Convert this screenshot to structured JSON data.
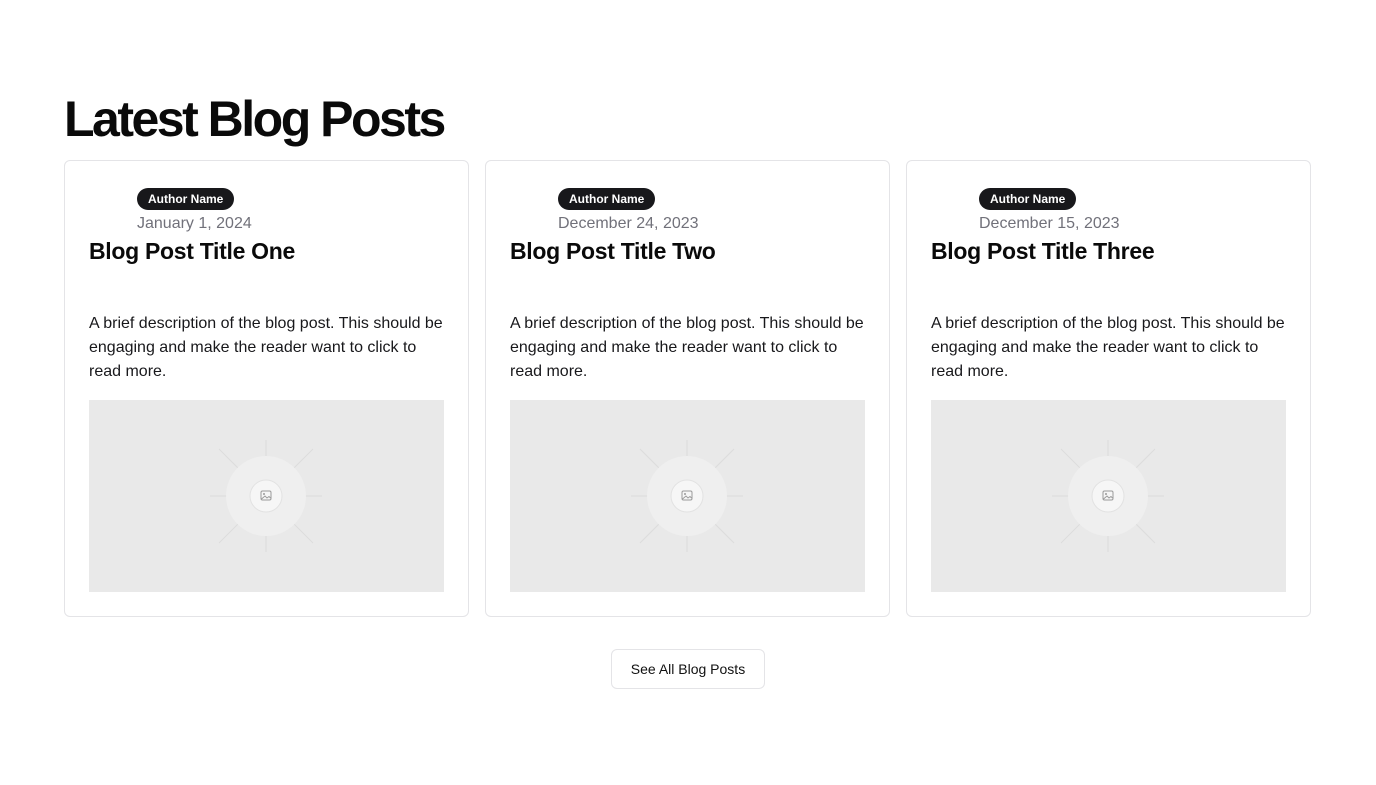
{
  "section": {
    "title": "Latest Blog Posts"
  },
  "posts": [
    {
      "author": "Author Name",
      "date": "January 1, 2024",
      "title": "Blog Post Title One",
      "description": "A brief description of the blog post. This should be engaging and make the reader want to click to read more.",
      "image_icon": "image-placeholder-icon"
    },
    {
      "author": "Author Name",
      "date": "December 24, 2023",
      "title": "Blog Post Title Two",
      "description": "A brief description of the blog post. This should be engaging and make the reader want to click to read more.",
      "image_icon": "image-placeholder-icon"
    },
    {
      "author": "Author Name",
      "date": "December 15, 2023",
      "title": "Blog Post Title Three",
      "description": "A brief description of the blog post. This should be engaging and make the reader want to click to read more.",
      "image_icon": "image-placeholder-icon"
    }
  ],
  "actions": {
    "see_all_label": "See All Blog Posts"
  },
  "colors": {
    "badge_bg": "#18181b",
    "date_text": "#71717a",
    "card_border": "#e4e4e7",
    "placeholder_bg": "#e9e9e9"
  }
}
